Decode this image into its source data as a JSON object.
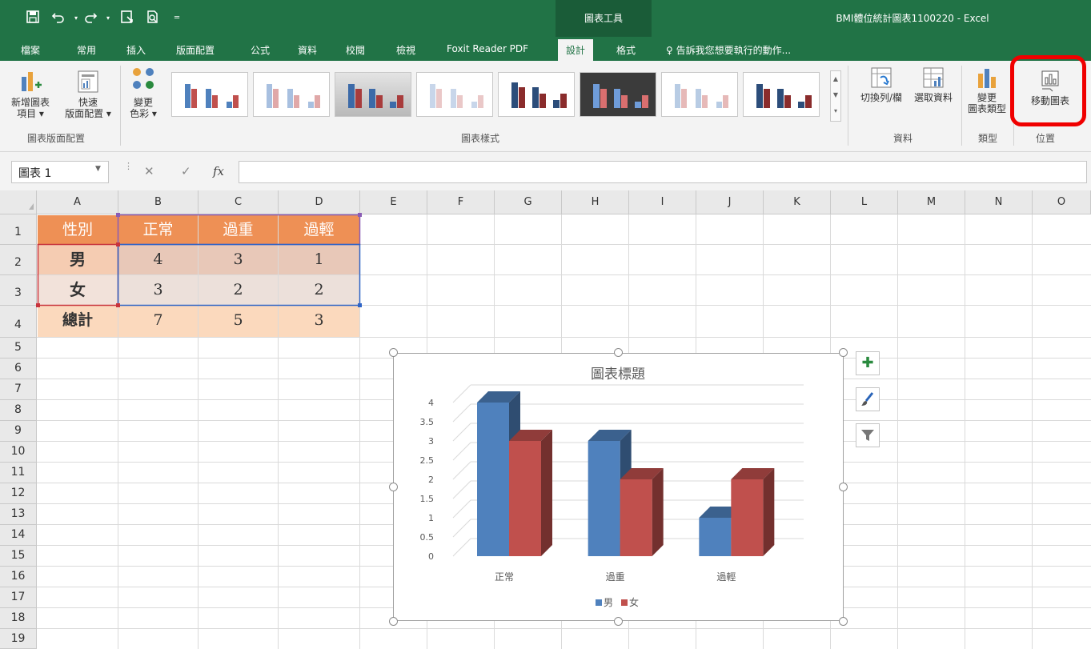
{
  "window": {
    "title": "BMI體位統計圖表1100220 - Excel",
    "contextual_group": "圖表工具"
  },
  "colors": {
    "excel_green": "#217346",
    "highlight": "#f00000",
    "series_male": "#4f81bd",
    "series_female": "#c0504d",
    "table_header": "#ee9055"
  },
  "quick_access": [
    "save-icon",
    "undo-icon",
    "redo-icon",
    "save-as-icon",
    "print-preview-icon",
    "customize-qat-icon"
  ],
  "tabs": [
    {
      "label": "檔案"
    },
    {
      "label": "常用"
    },
    {
      "label": "插入"
    },
    {
      "label": "版面配置"
    },
    {
      "label": "公式"
    },
    {
      "label": "資料"
    },
    {
      "label": "校閱"
    },
    {
      "label": "檢視"
    },
    {
      "label": "Foxit Reader PDF"
    },
    {
      "label": "設計"
    },
    {
      "label": "格式"
    }
  ],
  "tell_me": "告訴我您想要執行的動作...",
  "ribbon": {
    "add_element_line1": "新增圖表",
    "add_element_line2": "項目 ▾",
    "quick_layout_line1": "快速",
    "quick_layout_line2": "版面配置 ▾",
    "chart_layouts_group": "圖表版面配置",
    "change_colors_line1": "變更",
    "change_colors_line2": "色彩 ▾",
    "chart_styles_group": "圖表樣式",
    "switch_row_col": "切換列/欄",
    "select_data": "選取資料",
    "data_group": "資料",
    "change_type_line1": "變更",
    "change_type_line2": "圖表類型",
    "type_group": "類型",
    "move_chart": "移動圖表",
    "location_group": "位置"
  },
  "formula_bar": {
    "name_box": "圖表 1",
    "formula": ""
  },
  "columns": [
    "A",
    "B",
    "C",
    "D",
    "E",
    "F",
    "G",
    "H",
    "I",
    "J",
    "K",
    "L",
    "M",
    "N",
    "O"
  ],
  "rows": [
    "1",
    "2",
    "3",
    "4",
    "5",
    "6",
    "7",
    "8",
    "9",
    "10",
    "11",
    "12",
    "13",
    "14",
    "15",
    "16",
    "17",
    "18",
    "19"
  ],
  "table": {
    "header": [
      "性別",
      "正常",
      "過重",
      "過輕"
    ],
    "rows": [
      [
        "男",
        "4",
        "3",
        "1"
      ],
      [
        "女",
        "3",
        "2",
        "2"
      ],
      [
        "總計",
        "7",
        "5",
        "3"
      ]
    ]
  },
  "chart_data": {
    "type": "bar",
    "title": "圖表標題",
    "categories": [
      "正常",
      "過重",
      "過輕"
    ],
    "series": [
      {
        "name": "男",
        "values": [
          4,
          3,
          1
        ],
        "color": "#4f81bd"
      },
      {
        "name": "女",
        "values": [
          3,
          2,
          2
        ],
        "color": "#c0504d"
      }
    ],
    "ylim": [
      0,
      4
    ],
    "yticks": [
      "0",
      "0.5",
      "1",
      "1.5",
      "2",
      "2.5",
      "3",
      "3.5",
      "4"
    ],
    "grid": true,
    "legend": "bottom",
    "style": "3d-clustered-column"
  }
}
